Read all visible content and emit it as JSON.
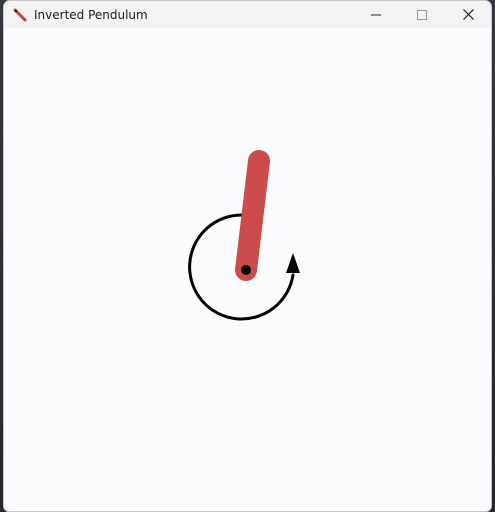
{
  "window": {
    "title": "Inverted Pendulum",
    "app_icon": "pendulum-app-icon"
  },
  "caption_buttons": {
    "minimize_icon": "minimize-icon",
    "maximize_icon": "maximize-icon",
    "close_icon": "close-icon"
  },
  "scene": {
    "rod_color": "#cc4b4b",
    "pivot_color": "#000000",
    "arrow_color": "#000000",
    "background": "#fcfbfd",
    "arrow_icon": "rotation-arrow-icon"
  }
}
